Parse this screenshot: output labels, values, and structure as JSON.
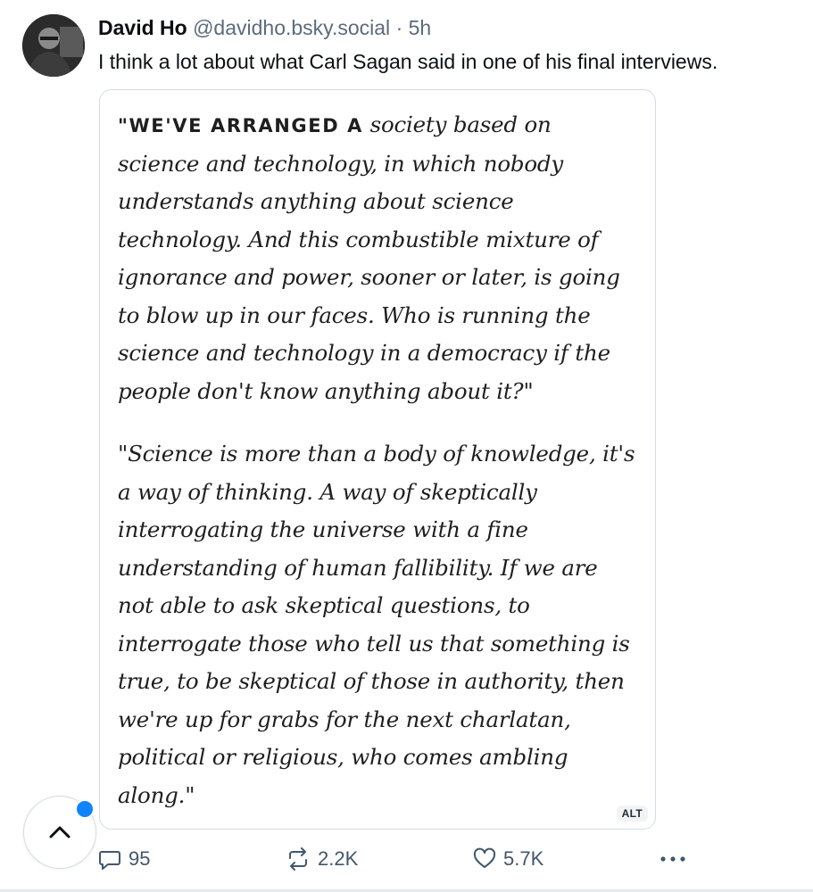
{
  "post": {
    "author_name": "David Ho",
    "author_handle": "@davidho.bsky.social",
    "separator": "·",
    "time": "5h",
    "text": "I think a lot about what Carl Sagan said in one of his final interviews."
  },
  "image": {
    "quote_lead": "\"WE'VE ARRANGED A",
    "lines_p1": [
      "society based on",
      "science and technology, in which nobody",
      "understands anything about science",
      "technology. And this combustible mixture of",
      "ignorance and power, sooner or later, is going",
      "to blow up in our faces. Who is running the",
      "science and technology in a democracy if the",
      "people don't know anything about it?\""
    ],
    "lines_p2": [
      "\"Science is more than a body of knowledge, it's",
      "a way of thinking. A way of skeptically",
      "interrogating the universe with a fine",
      "understanding of human fallibility. If we are",
      "not able to ask skeptical questions, to",
      "interrogate those who tell us that something is",
      "true, to be skeptical of those in authority, then",
      "we're up for grabs for the next charlatan,",
      "political or religious, who comes ambling",
      "along.\""
    ],
    "alt_label": "ALT"
  },
  "actions": {
    "reply_count": "95",
    "repost_count": "2.2K",
    "like_count": "5.7K"
  },
  "icons": {
    "reply": "speech-bubble-icon",
    "repost": "repost-arrows-icon",
    "like": "heart-icon",
    "more": "more-dots-icon",
    "scroll_top": "chevron-up-icon"
  },
  "colors": {
    "accent": "#1083fe",
    "muted_text": "#5b6b7b",
    "action_icon": "#42576c"
  }
}
